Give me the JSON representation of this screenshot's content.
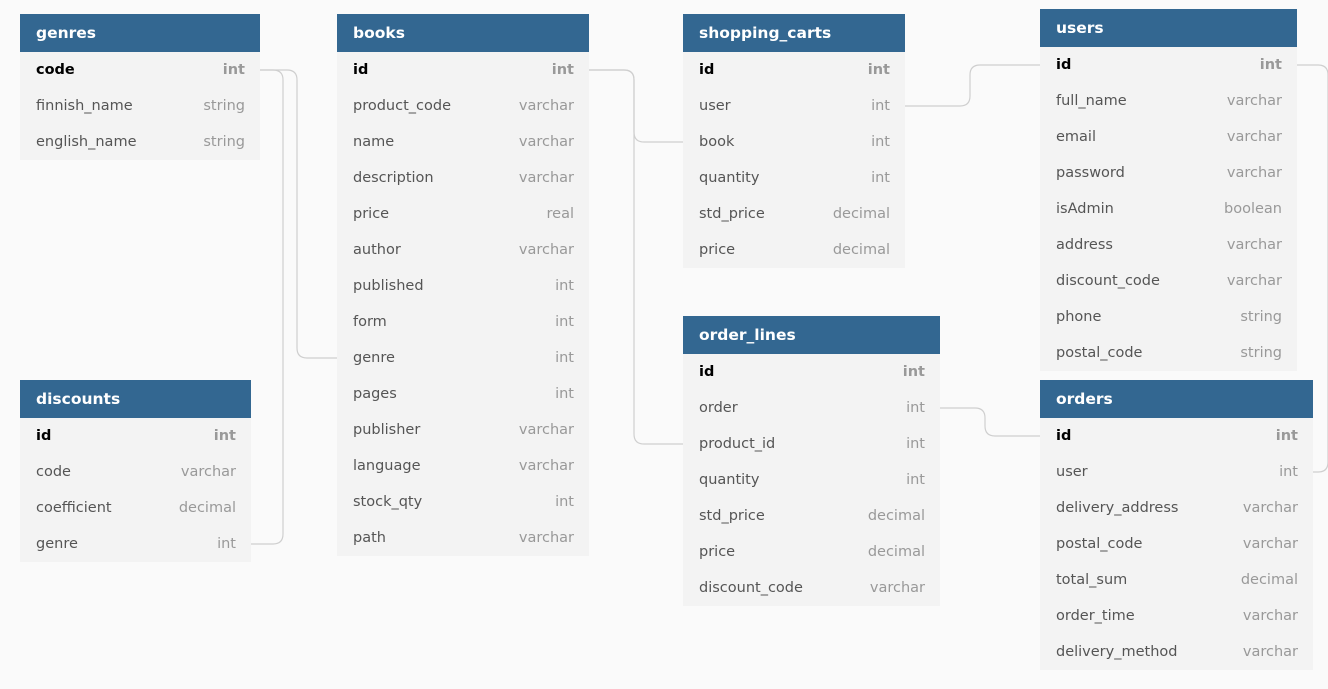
{
  "tables": [
    {
      "key": "genres",
      "title": "genres",
      "fields": [
        {
          "name": "code",
          "type": "int",
          "pk": true
        },
        {
          "name": "finnish_name",
          "type": "string"
        },
        {
          "name": "english_name",
          "type": "string"
        }
      ]
    },
    {
      "key": "discounts",
      "title": "discounts",
      "fields": [
        {
          "name": "id",
          "type": "int",
          "pk": true
        },
        {
          "name": "code",
          "type": "varchar"
        },
        {
          "name": "coefficient",
          "type": "decimal"
        },
        {
          "name": "genre",
          "type": "int"
        }
      ]
    },
    {
      "key": "books",
      "title": "books",
      "fields": [
        {
          "name": "id",
          "type": "int",
          "pk": true
        },
        {
          "name": "product_code",
          "type": "varchar"
        },
        {
          "name": "name",
          "type": "varchar"
        },
        {
          "name": "description",
          "type": "varchar"
        },
        {
          "name": "price",
          "type": "real"
        },
        {
          "name": "author",
          "type": "varchar"
        },
        {
          "name": "published",
          "type": "int"
        },
        {
          "name": "form",
          "type": "int"
        },
        {
          "name": "genre",
          "type": "int"
        },
        {
          "name": "pages",
          "type": "int"
        },
        {
          "name": "publisher",
          "type": "varchar"
        },
        {
          "name": "language",
          "type": "varchar"
        },
        {
          "name": "stock_qty",
          "type": "int"
        },
        {
          "name": "path",
          "type": "varchar"
        }
      ]
    },
    {
      "key": "shopping_carts",
      "title": "shopping_carts",
      "fields": [
        {
          "name": "id",
          "type": "int",
          "pk": true
        },
        {
          "name": "user",
          "type": "int"
        },
        {
          "name": "book",
          "type": "int"
        },
        {
          "name": "quantity",
          "type": "int"
        },
        {
          "name": "std_price",
          "type": "decimal"
        },
        {
          "name": "price",
          "type": "decimal"
        }
      ]
    },
    {
      "key": "order_lines",
      "title": "order_lines",
      "fields": [
        {
          "name": "id",
          "type": "int",
          "pk": true
        },
        {
          "name": "order",
          "type": "int"
        },
        {
          "name": "product_id",
          "type": "int"
        },
        {
          "name": "quantity",
          "type": "int"
        },
        {
          "name": "std_price",
          "type": "decimal"
        },
        {
          "name": "price",
          "type": "decimal"
        },
        {
          "name": "discount_code",
          "type": "varchar"
        }
      ]
    },
    {
      "key": "users",
      "title": "users",
      "fields": [
        {
          "name": "id",
          "type": "int",
          "pk": true
        },
        {
          "name": "full_name",
          "type": "varchar"
        },
        {
          "name": "email",
          "type": "varchar"
        },
        {
          "name": "password",
          "type": "varchar"
        },
        {
          "name": "isAdmin",
          "type": "boolean"
        },
        {
          "name": "address",
          "type": "varchar"
        },
        {
          "name": "discount_code",
          "type": "varchar"
        },
        {
          "name": "phone",
          "type": "string"
        },
        {
          "name": "postal_code",
          "type": "string"
        }
      ]
    },
    {
      "key": "orders",
      "title": "orders",
      "fields": [
        {
          "name": "id",
          "type": "int",
          "pk": true
        },
        {
          "name": "user",
          "type": "int"
        },
        {
          "name": "delivery_address",
          "type": "varchar"
        },
        {
          "name": "postal_code",
          "type": "varchar"
        },
        {
          "name": "total_sum",
          "type": "decimal"
        },
        {
          "name": "order_time",
          "type": "varchar"
        },
        {
          "name": "delivery_method",
          "type": "varchar"
        }
      ]
    }
  ],
  "relations": [
    {
      "from": "discounts.genre",
      "to": "genres.code"
    },
    {
      "from": "books.genre",
      "to": "genres.code"
    },
    {
      "from": "shopping_carts.book",
      "to": "books.id"
    },
    {
      "from": "order_lines.product_id",
      "to": "books.id"
    },
    {
      "from": "shopping_carts.user",
      "to": "users.id"
    },
    {
      "from": "order_lines.order",
      "to": "orders.id"
    },
    {
      "from": "orders.user",
      "to": "users.id"
    }
  ]
}
